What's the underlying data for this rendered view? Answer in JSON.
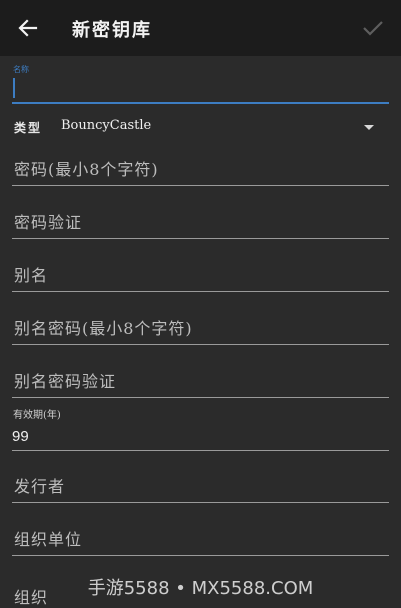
{
  "appbar": {
    "title": "新密钥库",
    "back_icon": "arrow-left-icon",
    "confirm_icon": "check-icon"
  },
  "form": {
    "name": {
      "floating_label": "名称",
      "value": ""
    },
    "type": {
      "label": "类型",
      "selected": "BouncyCastle"
    },
    "password": {
      "placeholder": "密码(最小8个字符)"
    },
    "password_verify": {
      "placeholder": "密码验证"
    },
    "alias": {
      "placeholder": "别名"
    },
    "alias_password": {
      "placeholder": "别名密码(最小8个字符)"
    },
    "alias_password_verify": {
      "placeholder": "别名密码验证"
    },
    "validity": {
      "label": "有效期(年)",
      "value": "99"
    },
    "issuer": {
      "placeholder": "发行者"
    },
    "org_unit": {
      "placeholder": "组织单位"
    },
    "org": {
      "placeholder": "组织"
    }
  },
  "watermark": {
    "text": "手游5588 • MX5588.COM"
  },
  "colors": {
    "accent": "#3d7dc2",
    "background": "#2b2b2b",
    "appbar": "#1c1c1c"
  }
}
